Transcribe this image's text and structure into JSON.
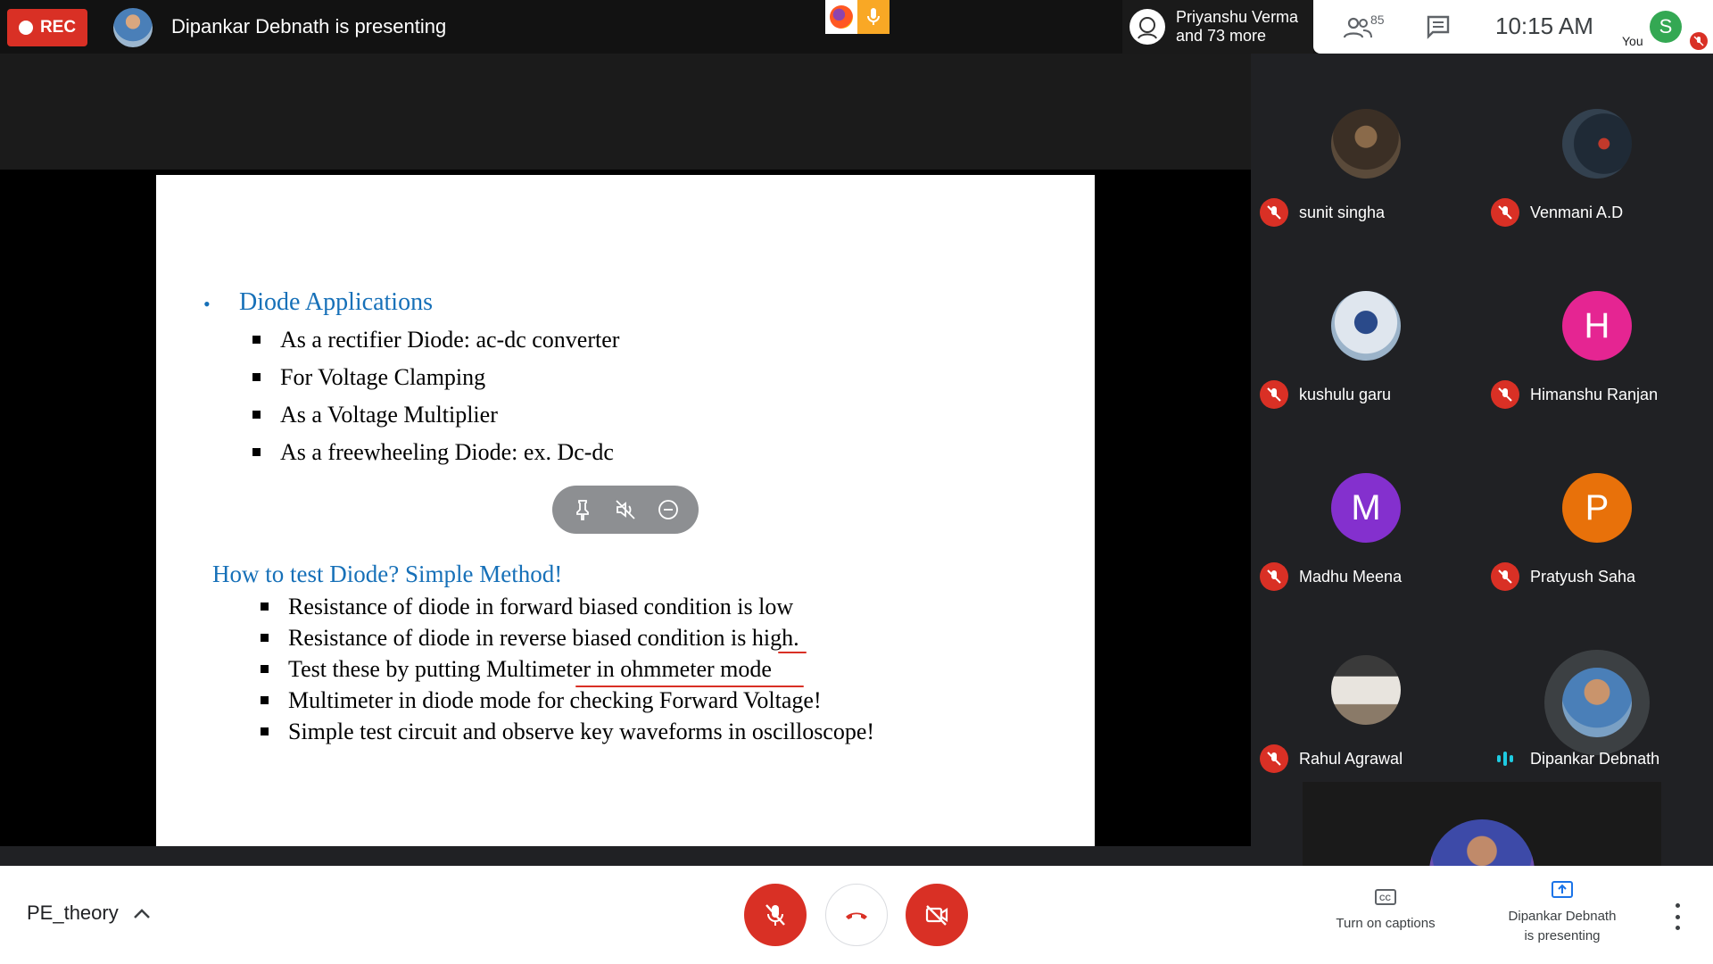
{
  "topbar": {
    "rec_label": "REC",
    "presenting_title": "Dipankar Debnath is presenting",
    "people_chip_line1": "Priyanshu Verma",
    "people_chip_line2": "and 73 more",
    "participant_count": "85",
    "time": "10:15 AM",
    "you_label": "You",
    "self_initial": "S"
  },
  "slide": {
    "heading1": "Diode Applications",
    "bullet": "•",
    "applications": [
      "As a  rectifier Diode: ac-dc converter",
      "For Voltage Clamping",
      "As a Voltage Multiplier",
      "As a freewheeling Diode: ex. Dc-dc"
    ],
    "heading2": "How to test Diode? Simple Method!",
    "tests": [
      "Resistance of diode in forward biased condition is low",
      "Resistance of diode in reverse biased condition is high.",
      "Test these by putting Multimeter in ohmmeter mode",
      "Multimeter in diode mode for checking Forward Voltage!",
      "Simple test circuit and observe key waveforms in oscilloscope!"
    ]
  },
  "participants": [
    {
      "name": "sunit singha",
      "initial": "",
      "avatar_color": "#5a4a3a"
    },
    {
      "name": "Venmani A.D",
      "initial": "",
      "avatar_color": "#33414f"
    },
    {
      "name": "kushulu garu",
      "initial": "",
      "avatar_color": "#9bb3c9"
    },
    {
      "name": "Himanshu Ranjan",
      "initial": "H",
      "avatar_color": "#e52592"
    },
    {
      "name": "Madhu Meena",
      "initial": "M",
      "avatar_color": "#8430ce"
    },
    {
      "name": "Pratyush Saha",
      "initial": "P",
      "avatar_color": "#e8710a"
    },
    {
      "name": "Rahul Agrawal",
      "initial": "",
      "avatar_color": "#c9b8a3"
    },
    {
      "name": "Dipankar Debnath",
      "initial": "",
      "avatar_color": "#4a7fb8"
    }
  ],
  "bottombar": {
    "meeting_name": "PE_theory",
    "captions_label": "Turn on captions",
    "presenting_line1": "Dipankar Debnath",
    "presenting_line2": "is presenting"
  },
  "colors": {
    "rec": "#d93025",
    "accent_blue": "#1670b8",
    "speaking": "#1ecbe1",
    "self_avatar": "#34a853"
  }
}
